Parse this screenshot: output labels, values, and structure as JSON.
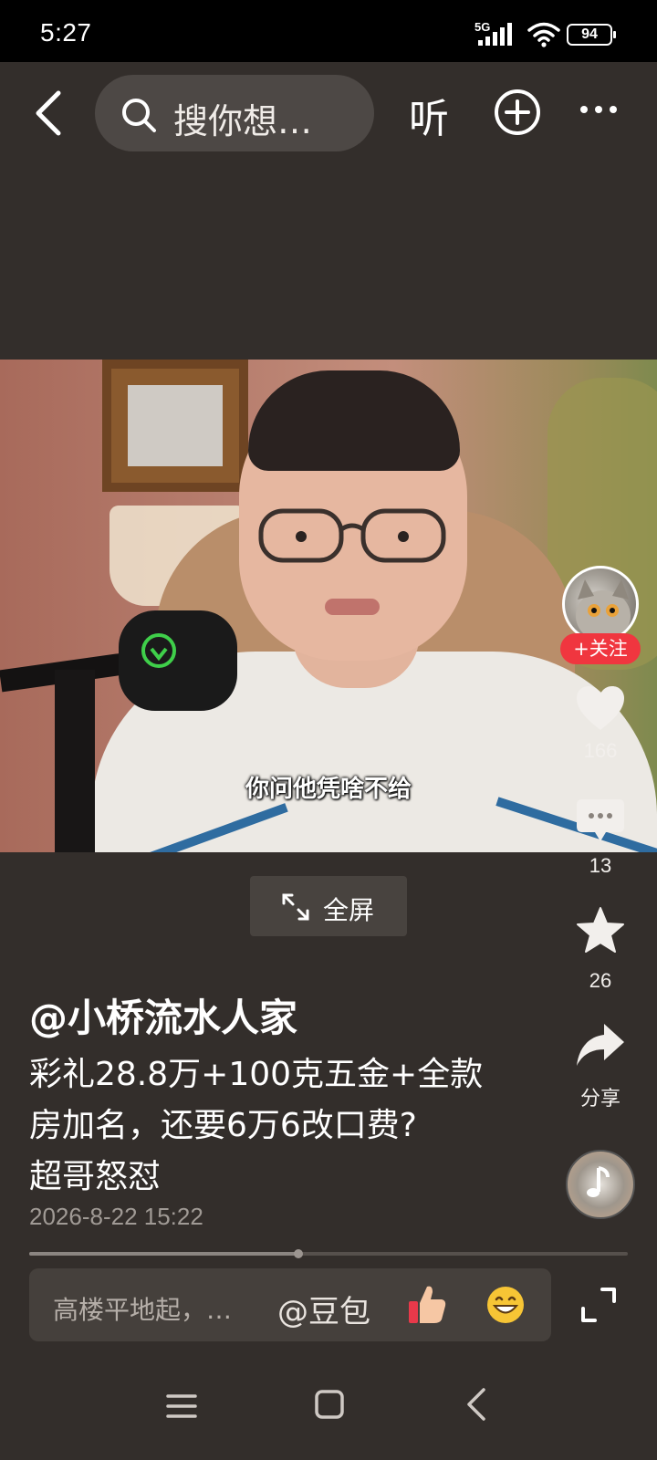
{
  "status_bar": {
    "time": "5:27",
    "network": "5G",
    "battery": "94"
  },
  "top_bar": {
    "search_placeholder": "搜你想…",
    "listen_label": "听"
  },
  "video": {
    "subtitle": "你问他凭啥不给",
    "fullscreen_label": "全屏"
  },
  "side_rail": {
    "follow_label": "+关注",
    "likes": "166",
    "comments": "13",
    "favorites": "26",
    "share_label": "分享"
  },
  "post": {
    "author": "@小桥流水人家",
    "description_lines": [
      "彩礼28.8万+100克五金+全款",
      "房加名，还要6万6改口费?",
      "超哥怒怼"
    ],
    "date": "2026-8-22 15:22"
  },
  "playback": {
    "progress": 0.45
  },
  "comment_bar": {
    "placeholder": "高楼平地起，…",
    "mention": "@豆包"
  },
  "icons": {
    "back": "back-arrow-icon",
    "search": "search-icon",
    "add": "plus-circle-icon",
    "more": "more-dots-icon",
    "fullscreen": "expand-arrows-icon",
    "like": "heart-icon",
    "comment": "comment-bubble-icon",
    "favorite": "star-icon",
    "share": "share-arrow-icon",
    "expand": "expand-icon",
    "nav_menu": "menu-lines-icon",
    "nav_home": "home-square-icon",
    "nav_back": "nav-back-icon"
  },
  "colors": {
    "background": "#332e2b",
    "follow_button": "#f0363f",
    "status_bar": "#000000"
  }
}
